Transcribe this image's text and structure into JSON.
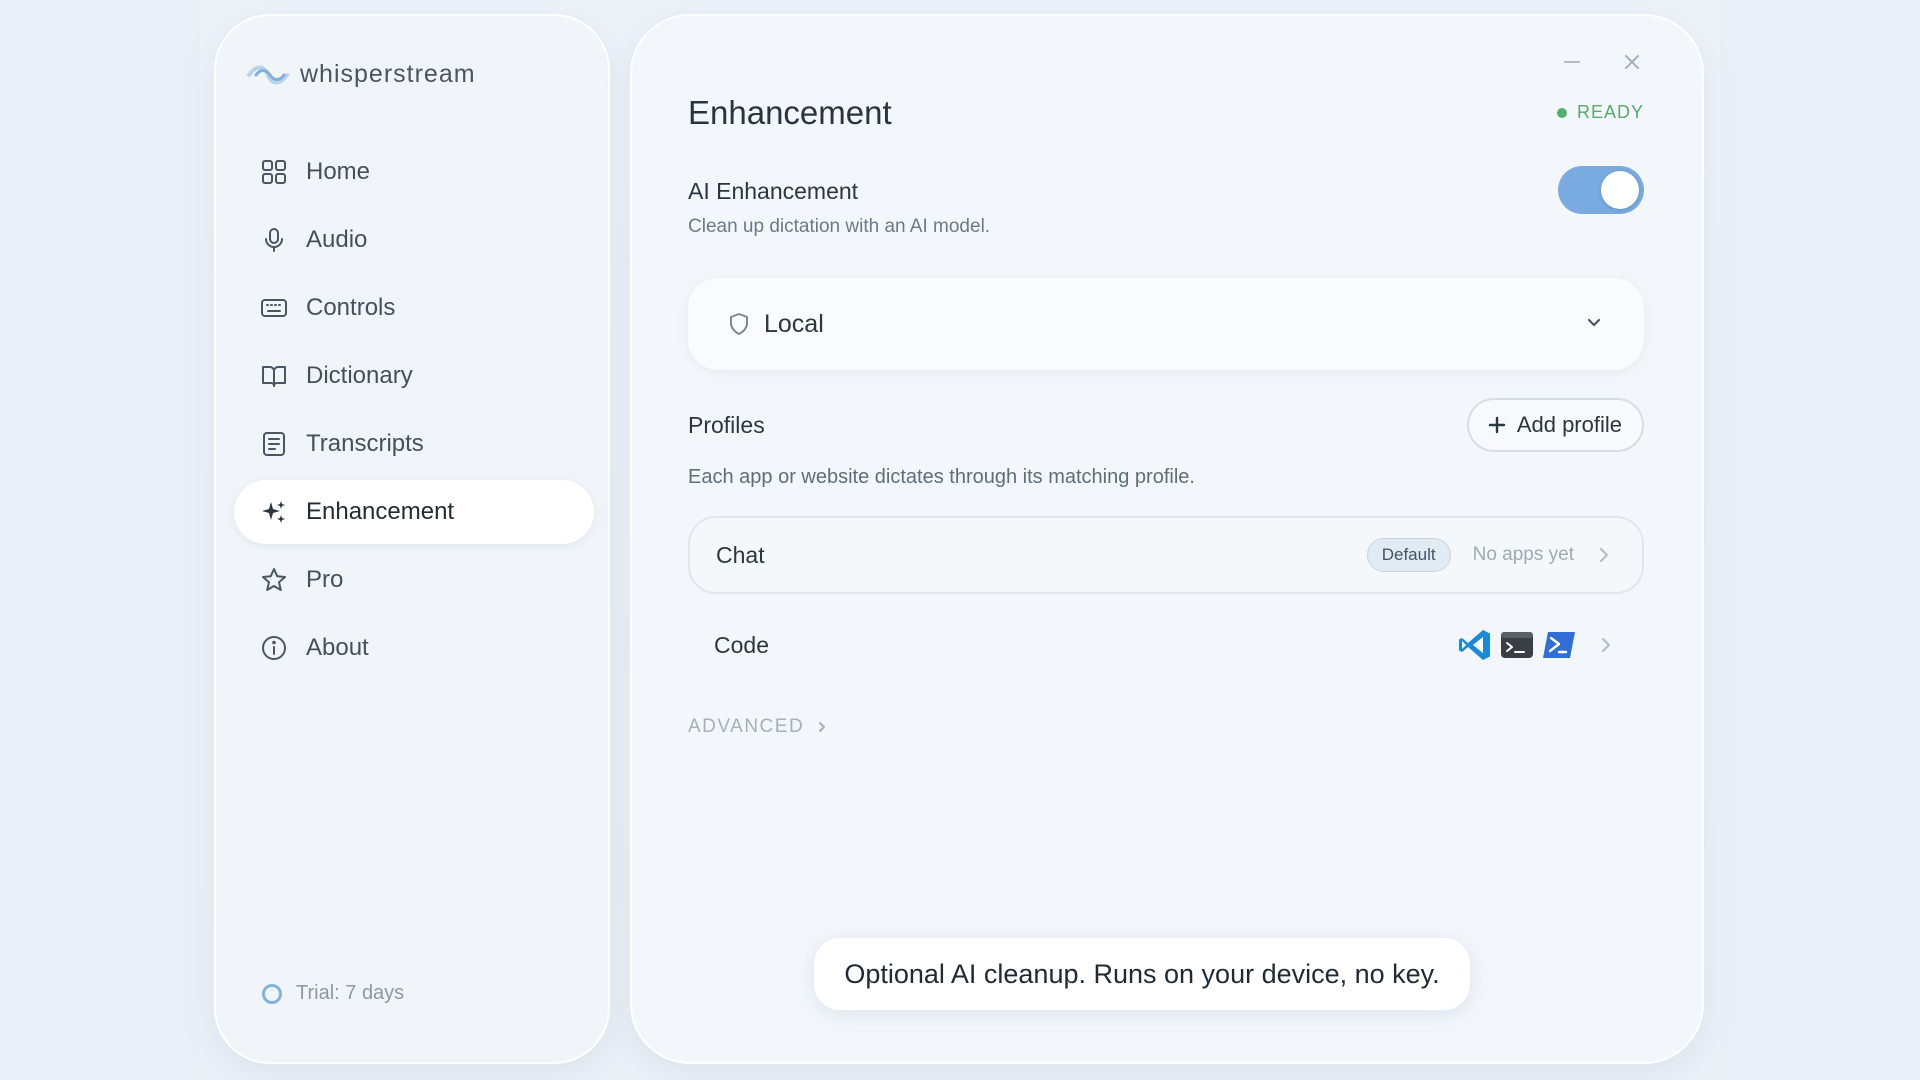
{
  "app": {
    "brand_name": "whisperstream"
  },
  "sidebar": {
    "items": [
      {
        "label": "Home",
        "icon": "home-grid-icon",
        "active": false
      },
      {
        "label": "Audio",
        "icon": "microphone-icon",
        "active": false
      },
      {
        "label": "Controls",
        "icon": "keyboard-icon",
        "active": false
      },
      {
        "label": "Dictionary",
        "icon": "book-icon",
        "active": false
      },
      {
        "label": "Transcripts",
        "icon": "document-lines-icon",
        "active": false
      },
      {
        "label": "Enhancement",
        "icon": "sparkles-icon",
        "active": true
      },
      {
        "label": "Pro",
        "icon": "star-icon",
        "active": false
      },
      {
        "label": "About",
        "icon": "info-icon",
        "active": false
      }
    ],
    "trial_label": "Trial: 7 days"
  },
  "window": {
    "minimize_icon": "minimize-icon",
    "close_icon": "close-icon"
  },
  "main": {
    "title": "Enhancement",
    "status": "READY",
    "ai": {
      "title": "AI Enhancement",
      "subtitle": "Clean up dictation with an AI model.",
      "enabled": true
    },
    "model_select": {
      "value": "Local",
      "icon": "shield-icon"
    },
    "profiles": {
      "title": "Profiles",
      "add_label": "Add profile",
      "subtitle": "Each app or website dictates through its matching profile.",
      "rows": [
        {
          "name": "Chat",
          "badge": "Default",
          "apps_text": "No apps yet"
        },
        {
          "name": "Code",
          "apps": [
            "vscode-icon",
            "terminal-icon",
            "powershell-icon"
          ]
        }
      ]
    },
    "advanced_label": "ADVANCED"
  },
  "toast": {
    "text": "Optional AI cleanup. Runs on your device, no key."
  },
  "colors": {
    "accent": "#79abe0",
    "ready": "#52b26a",
    "background": "#e9eff6"
  }
}
